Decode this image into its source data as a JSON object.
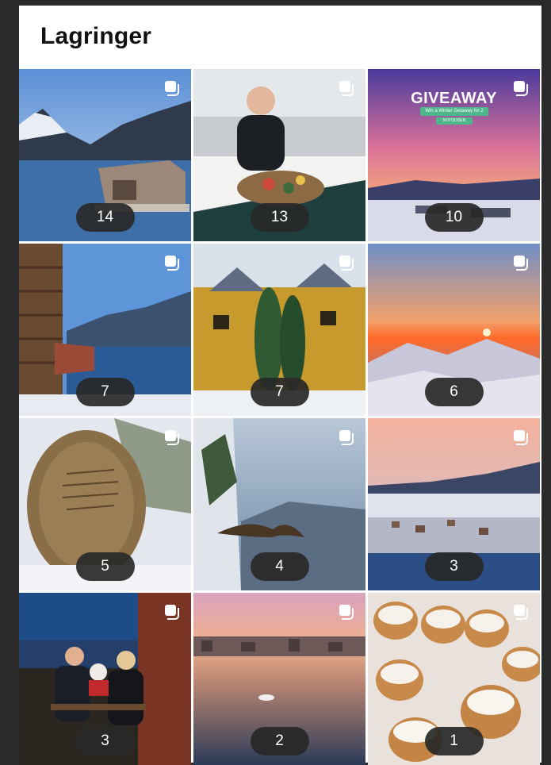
{
  "header": {
    "title": "Lagringer"
  },
  "icons": {
    "multi": "multiple-photos-icon"
  },
  "giveaway": {
    "title": "GIVEAWAY",
    "subtitle": "Win a Winter Getaway for 2",
    "tag": "NOTODDEN"
  },
  "tiles": [
    {
      "count": "14",
      "scene": "lake cabin with mountains and swimmers"
    },
    {
      "count": "13",
      "scene": "man at restaurant table with seafood platter"
    },
    {
      "count": "10",
      "scene": "pink sunset over snowy town, giveaway"
    },
    {
      "count": "7",
      "scene": "log cabin overlooking fjord"
    },
    {
      "count": "7",
      "scene": "yellow wooden hotel with towers in winter"
    },
    {
      "count": "6",
      "scene": "sunrise above clouds over snowy peaks"
    },
    {
      "count": "5",
      "scene": "snow covered memorial stone"
    },
    {
      "count": "4",
      "scene": "eagle flying over snowy forest"
    },
    {
      "count": "3",
      "scene": "snowy town by lake at dusk"
    },
    {
      "count": "3",
      "scene": "couple dining with teddy bear by window"
    },
    {
      "count": "2",
      "scene": "harbor at sunset with reflection"
    },
    {
      "count": "1",
      "scene": "cream buns on tray"
    }
  ]
}
